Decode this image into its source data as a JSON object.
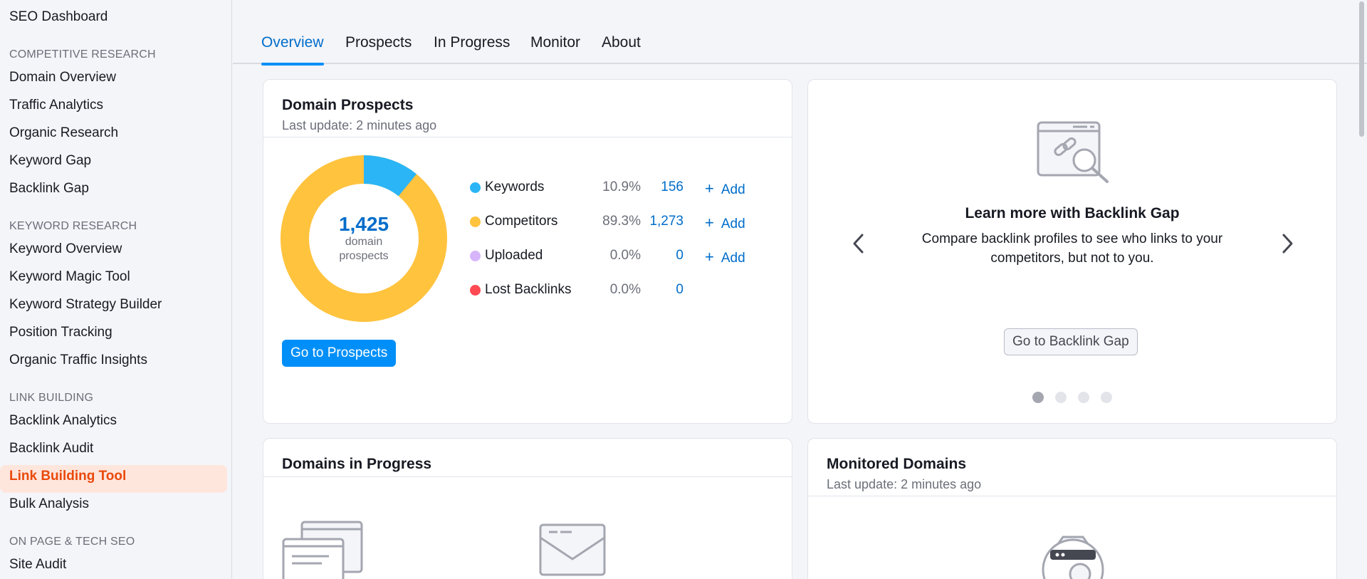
{
  "sidebar": {
    "top_item": "SEO Dashboard",
    "sections": [
      {
        "title": "COMPETITIVE RESEARCH",
        "items": [
          "Domain Overview",
          "Traffic Analytics",
          "Organic Research",
          "Keyword Gap",
          "Backlink Gap"
        ]
      },
      {
        "title": "KEYWORD RESEARCH",
        "items": [
          "Keyword Overview",
          "Keyword Magic Tool",
          "Keyword Strategy Builder",
          "Position Tracking",
          "Organic Traffic Insights"
        ]
      },
      {
        "title": "LINK BUILDING",
        "items": [
          "Backlink Analytics",
          "Backlink Audit",
          "Link Building Tool",
          "Bulk Analysis"
        ]
      },
      {
        "title": "ON PAGE & TECH SEO",
        "items": [
          "Site Audit"
        ]
      }
    ],
    "active_item": "Link Building Tool"
  },
  "tabs": [
    "Overview",
    "Prospects",
    "In Progress",
    "Monitor",
    "About"
  ],
  "active_tab": "Overview",
  "domain_prospects": {
    "title": "Domain Prospects",
    "subtitle": "Last update: 2 minutes ago",
    "total": "1,425",
    "total_label_line1": "domain",
    "total_label_line2": "prospects",
    "rows": [
      {
        "name": "Keywords",
        "pct": "10.9%",
        "count": "156",
        "add": "Add",
        "color": "#2bb5f6",
        "fraction": 0.109
      },
      {
        "name": "Competitors",
        "pct": "89.3%",
        "count": "1,273",
        "add": "Add",
        "color": "#ffc33e",
        "fraction": 0.893
      },
      {
        "name": "Uploaded",
        "pct": "0.0%",
        "count": "0",
        "add": "Add",
        "color": "#d7b5fb",
        "fraction": 0
      },
      {
        "name": "Lost Backlinks",
        "pct": "0.0%",
        "count": "0",
        "add": "",
        "color": "#ff4953",
        "fraction": 0
      }
    ],
    "button": "Go to Prospects"
  },
  "promo": {
    "title": "Learn more with Backlink Gap",
    "text": "Compare backlink profiles to see who links to your competitors, but not to you.",
    "button": "Go to Backlink Gap",
    "page_count": 4,
    "active_page": 1
  },
  "in_progress": {
    "title": "Domains in Progress"
  },
  "monitored": {
    "title": "Monitored Domains",
    "subtitle": "Last update: 2 minutes ago"
  },
  "colors": {
    "accent": "#008ff8",
    "link": "#006dca",
    "active_nav_bg": "#ffe6dd",
    "active_nav_text": "#e9490b"
  }
}
